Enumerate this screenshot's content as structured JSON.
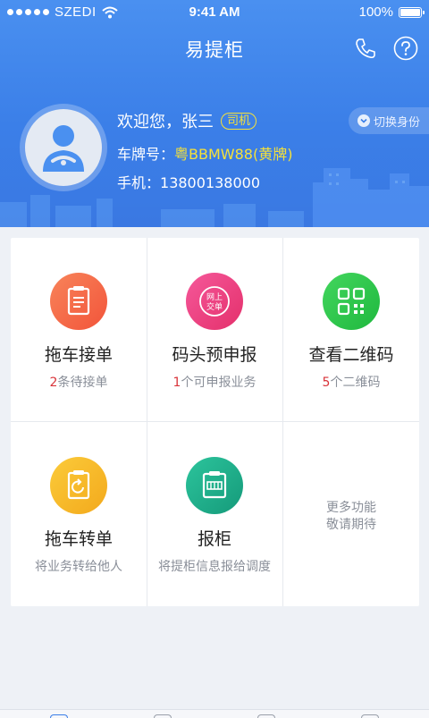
{
  "status_bar": {
    "carrier": "SZEDI",
    "time": "9:41 AM",
    "battery": "100%"
  },
  "nav": {
    "title": "易提柜",
    "icons": [
      "phone-icon",
      "help-icon"
    ]
  },
  "profile": {
    "greeting": "欢迎您，张三",
    "role_badge": "司机",
    "plate_label": "车牌号：",
    "plate_value": "粤BBMW88(黄牌)",
    "phone_label": "手机：",
    "phone_value": "13800138000",
    "switch_label": "切换身份"
  },
  "features": [
    {
      "title": "拖车接单",
      "count": "2",
      "sub": "条待接单",
      "icon": "clipboard-icon",
      "color": "#f56a48"
    },
    {
      "title": "码头预申报",
      "count": "1",
      "sub": "个可申报业务",
      "icon": "online-order-icon",
      "icon_text": [
        "网上",
        "交单"
      ],
      "color": "#ee3f7e"
    },
    {
      "title": "查看二维码",
      "count": "5",
      "sub": "个二维码",
      "icon": "qr-code-icon",
      "color": "#2cc84a"
    },
    {
      "title": "拖车转单",
      "count": "",
      "sub": "将业务转给他人",
      "icon": "transfer-icon",
      "color": "#f7b928"
    },
    {
      "title": "报柜",
      "count": "",
      "sub": "将提柜信息报给调度",
      "icon": "container-icon",
      "color": "#21b08e"
    }
  ],
  "more": {
    "line1": "更多功能",
    "line2": "敬请期待"
  },
  "colors": {
    "header_blue": "#3b7fe8",
    "badge_yellow": "#f5e13a",
    "count_red": "#d9343a"
  }
}
